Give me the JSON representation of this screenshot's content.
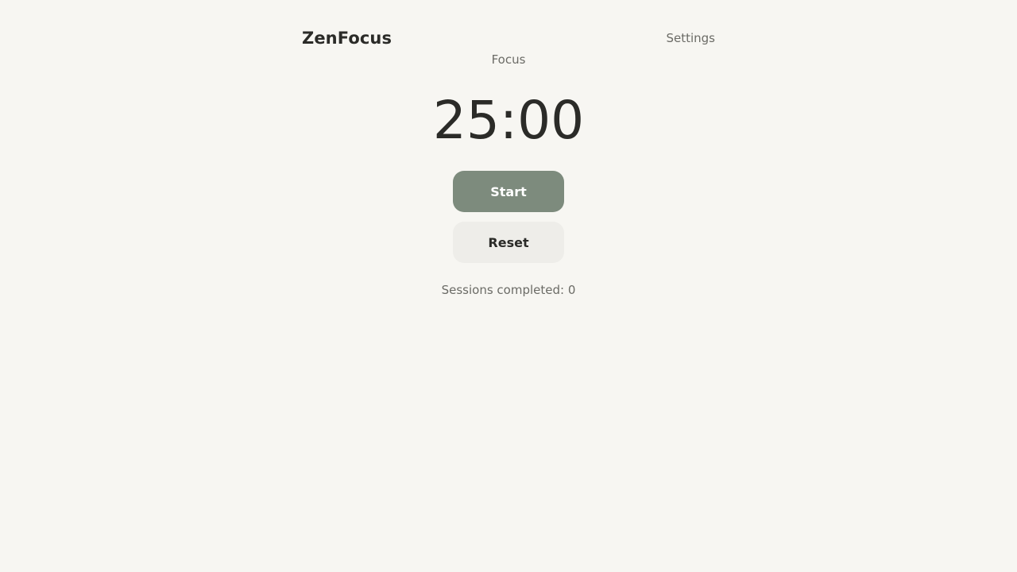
{
  "app": {
    "title": "ZenFocus"
  },
  "header": {
    "settings_label": "Settings"
  },
  "timer": {
    "mode": "Focus",
    "time": "25:00"
  },
  "controls": {
    "start_label": "Start",
    "reset_label": "Reset"
  },
  "stats": {
    "sessions_text": "Sessions completed: 0"
  },
  "colors": {
    "background": "#f7f6f2",
    "primary_button": "#7d8b7d",
    "secondary_button": "#eeede9",
    "text": "#2b2b28",
    "muted_text": "#6b6b66"
  }
}
